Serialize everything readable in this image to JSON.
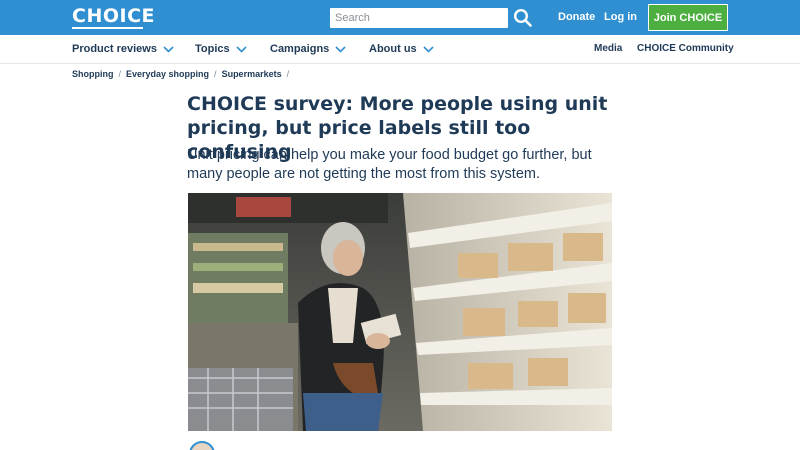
{
  "header": {
    "logo_text": "CHOICE",
    "search_placeholder": "Search",
    "search_icon": "search-icon",
    "donate_label": "Donate",
    "login_label": "Log in",
    "join_label": "Join CHOICE",
    "brand_color": "#2f8fd0",
    "join_color": "#4caf3f"
  },
  "nav": {
    "items": [
      {
        "label": "Product reviews",
        "icon": "chevron-down-icon"
      },
      {
        "label": "Topics",
        "icon": "chevron-down-icon"
      },
      {
        "label": "Campaigns",
        "icon": "chevron-down-icon"
      },
      {
        "label": "About us",
        "icon": "chevron-down-icon"
      }
    ],
    "right": [
      {
        "label": "Media"
      },
      {
        "label": "CHOICE Community"
      }
    ]
  },
  "breadcrumb": {
    "items": [
      "Shopping",
      "Everyday shopping",
      "Supermarkets"
    ],
    "separator": "/"
  },
  "article": {
    "title": "CHOICE survey: More people using unit pricing, but price labels still too confusing",
    "subtitle": "Unit pricing can help you make your food budget go further, but many people are not getting the most from this system.",
    "hero_image": "photo-woman-shopping-supermarket-aisle"
  }
}
